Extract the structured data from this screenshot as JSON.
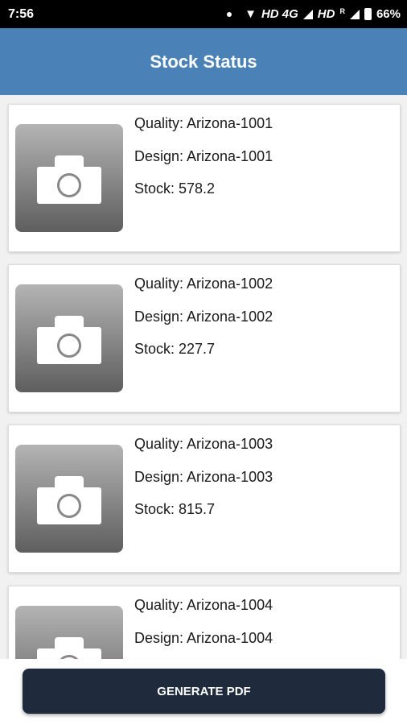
{
  "status_bar": {
    "time": "7:56",
    "network_left": "HD 4G",
    "network_right": "HD",
    "roaming": "R",
    "battery": "66%"
  },
  "app_bar": {
    "title": "Stock Status"
  },
  "items": [
    {
      "quality": "Quality: Arizona-1001",
      "design": "Design: Arizona-1001",
      "stock": "Stock: 578.2"
    },
    {
      "quality": "Quality: Arizona-1002",
      "design": "Design: Arizona-1002",
      "stock": "Stock: 227.7"
    },
    {
      "quality": "Quality: Arizona-1003",
      "design": "Design: Arizona-1003",
      "stock": "Stock: 815.7"
    },
    {
      "quality": "Quality: Arizona-1004",
      "design": "Design: Arizona-1004",
      "stock": ""
    }
  ],
  "footer": {
    "button_label": "GENERATE PDF"
  }
}
